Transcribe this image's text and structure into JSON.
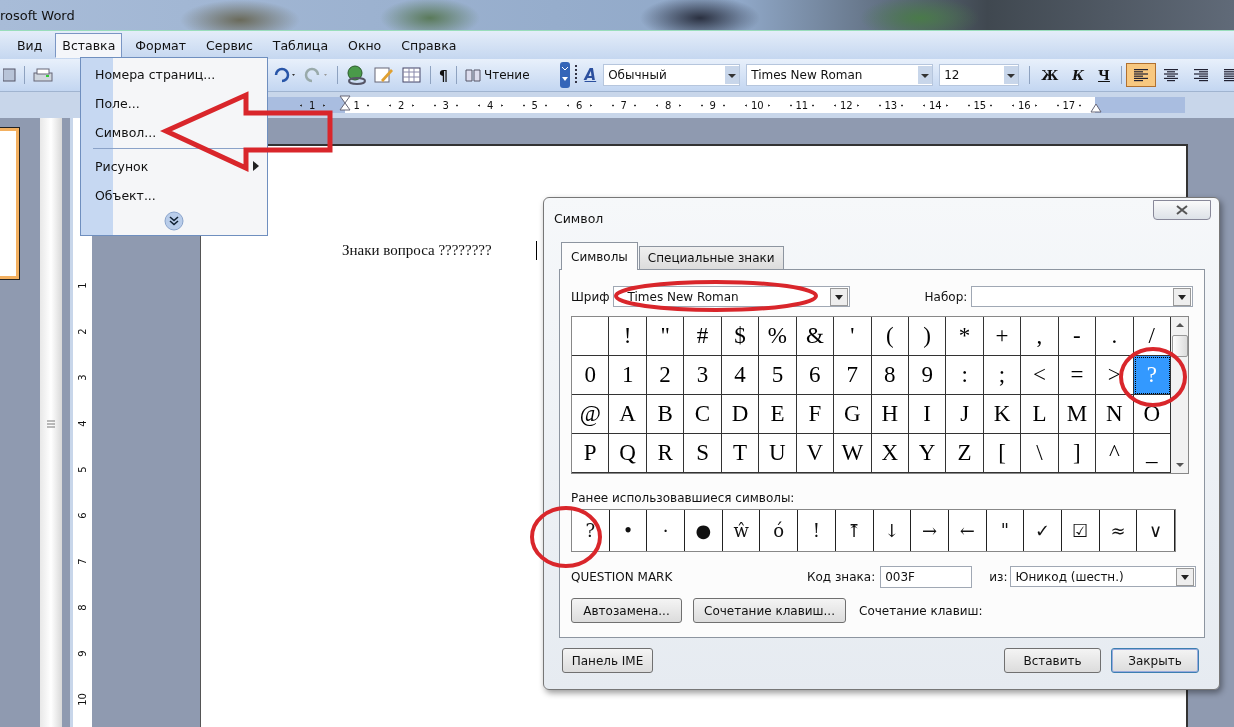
{
  "window": {
    "title": "rosoft Word"
  },
  "menu_bar": [
    {
      "label": "Вид",
      "selected": false
    },
    {
      "label": "Вставка",
      "selected": true
    },
    {
      "label": "Формат",
      "selected": false
    },
    {
      "label": "Сервис",
      "selected": false
    },
    {
      "label": "Таблица",
      "selected": false
    },
    {
      "label": "Окно",
      "selected": false
    },
    {
      "label": "Справка",
      "selected": false
    }
  ],
  "insert_menu": [
    {
      "kind": "item",
      "label": "Номера страниц..."
    },
    {
      "kind": "item",
      "label": "Поле..."
    },
    {
      "kind": "item",
      "label": "Символ..."
    },
    {
      "kind": "separator"
    },
    {
      "kind": "submenu",
      "label": "Рисунок"
    },
    {
      "kind": "item",
      "label": "Объект..."
    }
  ],
  "toolbar": {
    "show_marks": "¶",
    "reading_button": "Чтение",
    "styles_glyph": "A",
    "style": "Обычный",
    "font": "Times New Roman",
    "size": "12",
    "format_buttons": [
      "Ж",
      "К",
      "Ч"
    ],
    "alignment": [
      {
        "kind": "left",
        "selected": true
      },
      {
        "kind": "center",
        "selected": false
      },
      {
        "kind": "right",
        "selected": false
      },
      {
        "kind": "justify",
        "selected": false
      }
    ]
  },
  "horizontal_ruler": [
    "1",
    "1",
    "2",
    "3",
    "4",
    "5",
    "6",
    "7",
    "8",
    "9",
    "10",
    "11",
    "12",
    "13",
    "14",
    "15",
    "16",
    "17"
  ],
  "vertical_ruler": [
    "1",
    "2",
    "3",
    "4",
    "5",
    "6",
    "7",
    "8",
    "9",
    "10"
  ],
  "document": {
    "text": "Знаки вопроса ????????"
  },
  "symbol_dialog": {
    "title": "Символ",
    "tabs": [
      {
        "label": "Символы",
        "selected": true
      },
      {
        "label": "Специальные знаки",
        "selected": false
      }
    ],
    "font_label": "Шриф",
    "font": "Times New Roman",
    "subset_label": "Набор:",
    "grid": [
      [
        {
          "selected": false
        },
        {
          "char": "!",
          "selected": false
        },
        {
          "char": "\"",
          "selected": false
        },
        {
          "char": "#",
          "selected": false
        },
        {
          "char": "$",
          "selected": false
        },
        {
          "char": "%",
          "selected": false
        },
        {
          "char": "&",
          "selected": false
        },
        {
          "char": "'",
          "selected": false
        },
        {
          "char": "(",
          "selected": false
        },
        {
          "char": ")",
          "selected": false
        },
        {
          "char": "*",
          "selected": false
        },
        {
          "char": "+",
          "selected": false
        },
        {
          "char": ",",
          "selected": false
        },
        {
          "char": "-",
          "selected": false
        },
        {
          "char": ".",
          "selected": false
        },
        {
          "char": "/",
          "selected": false
        }
      ],
      [
        {
          "char": "0",
          "selected": false
        },
        {
          "char": "1",
          "selected": false
        },
        {
          "char": "2",
          "selected": false
        },
        {
          "char": "3",
          "selected": false
        },
        {
          "char": "4",
          "selected": false
        },
        {
          "char": "5",
          "selected": false
        },
        {
          "char": "6",
          "selected": false
        },
        {
          "char": "7",
          "selected": false
        },
        {
          "char": "8",
          "selected": false
        },
        {
          "char": "9",
          "selected": false
        },
        {
          "char": ":",
          "selected": false
        },
        {
          "char": ";",
          "selected": false
        },
        {
          "char": "<",
          "selected": false
        },
        {
          "char": "=",
          "selected": false
        },
        {
          "char": ">",
          "selected": false
        },
        {
          "char": "?",
          "selected": true
        }
      ],
      [
        {
          "char": "@",
          "selected": false
        },
        {
          "char": "A",
          "selected": false
        },
        {
          "char": "B",
          "selected": false
        },
        {
          "char": "C",
          "selected": false
        },
        {
          "char": "D",
          "selected": false
        },
        {
          "char": "E",
          "selected": false
        },
        {
          "char": "F",
          "selected": false
        },
        {
          "char": "G",
          "selected": false
        },
        {
          "char": "H",
          "selected": false
        },
        {
          "char": "I",
          "selected": false
        },
        {
          "char": "J",
          "selected": false
        },
        {
          "char": "K",
          "selected": false
        },
        {
          "char": "L",
          "selected": false
        },
        {
          "char": "M",
          "selected": false
        },
        {
          "char": "N",
          "selected": false
        },
        {
          "char": "O",
          "selected": false
        }
      ],
      [
        {
          "char": "P",
          "selected": false
        },
        {
          "char": "Q",
          "selected": false
        },
        {
          "char": "R",
          "selected": false
        },
        {
          "char": "S",
          "selected": false
        },
        {
          "char": "T",
          "selected": false
        },
        {
          "char": "U",
          "selected": false
        },
        {
          "char": "V",
          "selected": false
        },
        {
          "char": "W",
          "selected": false
        },
        {
          "char": "X",
          "selected": false
        },
        {
          "char": "Y",
          "selected": false
        },
        {
          "char": "Z",
          "selected": false
        },
        {
          "char": "[",
          "selected": false
        },
        {
          "char": "\\",
          "selected": false
        },
        {
          "char": "]",
          "selected": false
        },
        {
          "char": "^",
          "selected": false
        },
        {
          "char": "_",
          "selected": false
        }
      ]
    ],
    "recent_label": "Ранее использовавшиеся символы:",
    "recent": [
      "?",
      "•",
      "·",
      "●",
      "ŵ",
      "ó",
      "!",
      "⤒",
      "↓",
      "→",
      "←",
      "\"",
      "✓",
      "☑",
      "≈",
      "∨"
    ],
    "char_name": "QUESTION MARK",
    "code_label": "Код знака:",
    "code": "003F",
    "from_label": "из:",
    "from": "Юникод (шестн.)",
    "autocorrect_button": "Автозамена...",
    "shortcut_button": "Сочетание клавиш...",
    "shortcut_label": "Сочетание клавиш:",
    "ime_button": "Панель IME",
    "insert_button": "Вставить",
    "close_button": "Закрыть"
  }
}
